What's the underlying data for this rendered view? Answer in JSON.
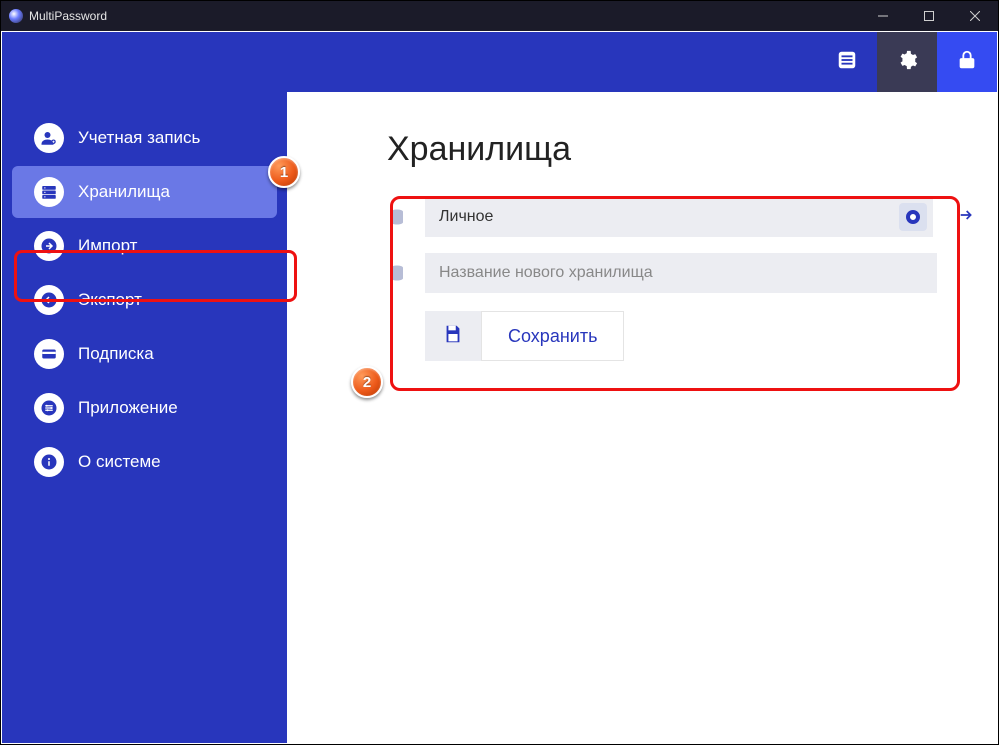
{
  "window": {
    "title": "MultiPassword"
  },
  "header": {
    "buttons": [
      "list",
      "settings",
      "lock"
    ]
  },
  "sidebar": {
    "items": [
      {
        "label": "Учетная запись",
        "icon": "account-icon"
      },
      {
        "label": "Хранилища",
        "icon": "storage-icon",
        "active": true
      },
      {
        "label": "Импорт",
        "icon": "import-icon"
      },
      {
        "label": "Экспорт",
        "icon": "export-icon"
      },
      {
        "label": "Подписка",
        "icon": "card-icon"
      },
      {
        "label": "Приложение",
        "icon": "sliders-icon"
      },
      {
        "label": "О системе",
        "icon": "info-icon"
      }
    ]
  },
  "main": {
    "title": "Хранилища",
    "vault_name": "Личное",
    "new_vault_placeholder": "Название нового хранилища",
    "save_label": "Сохранить"
  },
  "annotations": {
    "callout1": "1",
    "callout2": "2"
  }
}
